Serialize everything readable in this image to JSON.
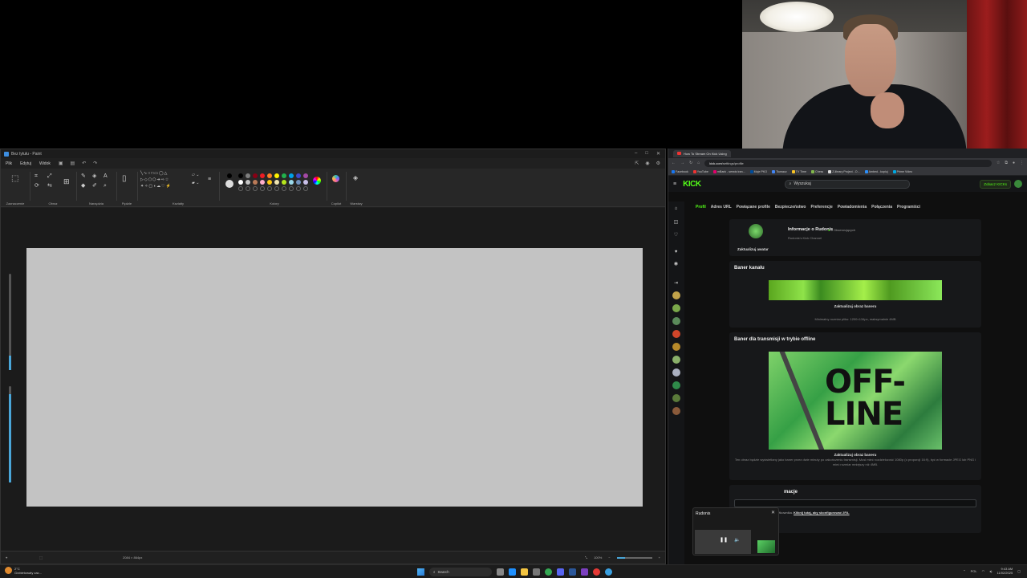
{
  "paint": {
    "title": "Bez tytułu - Paint",
    "menu": [
      "Plik",
      "Edytuj",
      "Widok"
    ],
    "groups": [
      "Zaznaczenie",
      "Obraz",
      "Narzędzia",
      "Pędzle",
      "Kształty",
      "Kolory",
      "Copilot",
      "Warstwy"
    ],
    "canvas_size": "2084 × 864px",
    "zoom": "100%"
  },
  "browser": {
    "tab_title": "How To Stream On Kick Using",
    "url_host": "kick.com",
    "url_path": "/settings/profile",
    "bookmarks": [
      "Facebook",
      "YouTube",
      "mBank - serwis tran...",
      "Moje PKO",
      "Tłumacz",
      "TV Time",
      "Chess",
      "Z-library Project - O...",
      "Ambed - kopiuj",
      "Prime Video"
    ]
  },
  "kick": {
    "logo": "KICK",
    "search_placeholder": "Wyszukaj",
    "see_kicks": "Zobacz KICKs",
    "tabs": [
      "Profil",
      "Adres URL",
      "Powiązane profile",
      "Bezpieczeństwo",
      "Preferencje",
      "Powiadomienia",
      "Połączenia",
      "Programiści"
    ],
    "profile": {
      "update_avatar": "Zaktualizuj awatar",
      "info_title": "Informacje o Rudonis",
      "followers": "0 Obserwujących",
      "channel_desc": "Rudonis's Kick Channel"
    },
    "banner": {
      "title": "Baner kanału",
      "update": "Zaktualizuj obraz baneru",
      "hint": "Minimalny rozmiar pliku: 1200×134px, maksymalnie 4MB"
    },
    "offline": {
      "title": "Baner dla transmisji w trybie offline",
      "image_text": "OFF-LINE",
      "update": "Zaktualizuj obraz baneru",
      "desc": "Ten obraz będzie wyświetlany jako baner przez dwie minuty po zakończeniu transmisji. Musi mieć rozdzielczość 1080p (o proporcji 16:9), być w formacie JPEG lub PNG i mieć rozmiar mniejszy niż 4MB."
    },
    "info_section": {
      "title": "macje",
      "hint_prefix": "zaktualizować swoją nazwę użytkownika.",
      "hint_link": "Kliknij tutaj, aby skonfigurować 2FA."
    },
    "mini_player": {
      "name": "Rudonis"
    }
  },
  "taskbar": {
    "weather_temp": "2°C",
    "weather_desc": "Grzbietowaty zac...",
    "search": "Search",
    "lang": "POL",
    "time": "9:43 AM",
    "date": "11/02/2025"
  },
  "colors": {
    "kick_green": "#53fc18",
    "paint_bg": "#202020",
    "canvas": "#c3c3c3"
  }
}
